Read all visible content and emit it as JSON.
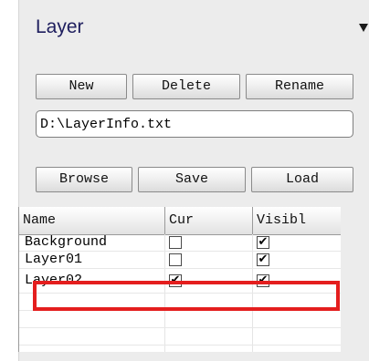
{
  "panel": {
    "title": "Layer",
    "buttons_top": {
      "new": "New",
      "delete": "Delete",
      "rename": "Rename"
    },
    "path_input": {
      "value": "D:\\LayerInfo.txt"
    },
    "buttons_file": {
      "browse": "Browse",
      "save": "Save",
      "load": "Load"
    },
    "table": {
      "columns": [
        "Name",
        "Cur",
        "Visibl"
      ],
      "rows": [
        {
          "name": "Background",
          "cur": "",
          "visible": "✔"
        },
        {
          "name": "Layer01",
          "cur": "",
          "visible": "✔"
        },
        {
          "name": "Layer02",
          "cur": "✔",
          "visible": "✔"
        }
      ]
    }
  },
  "colors": {
    "highlight": "#e41e1e",
    "title": "#1e1e5e"
  }
}
